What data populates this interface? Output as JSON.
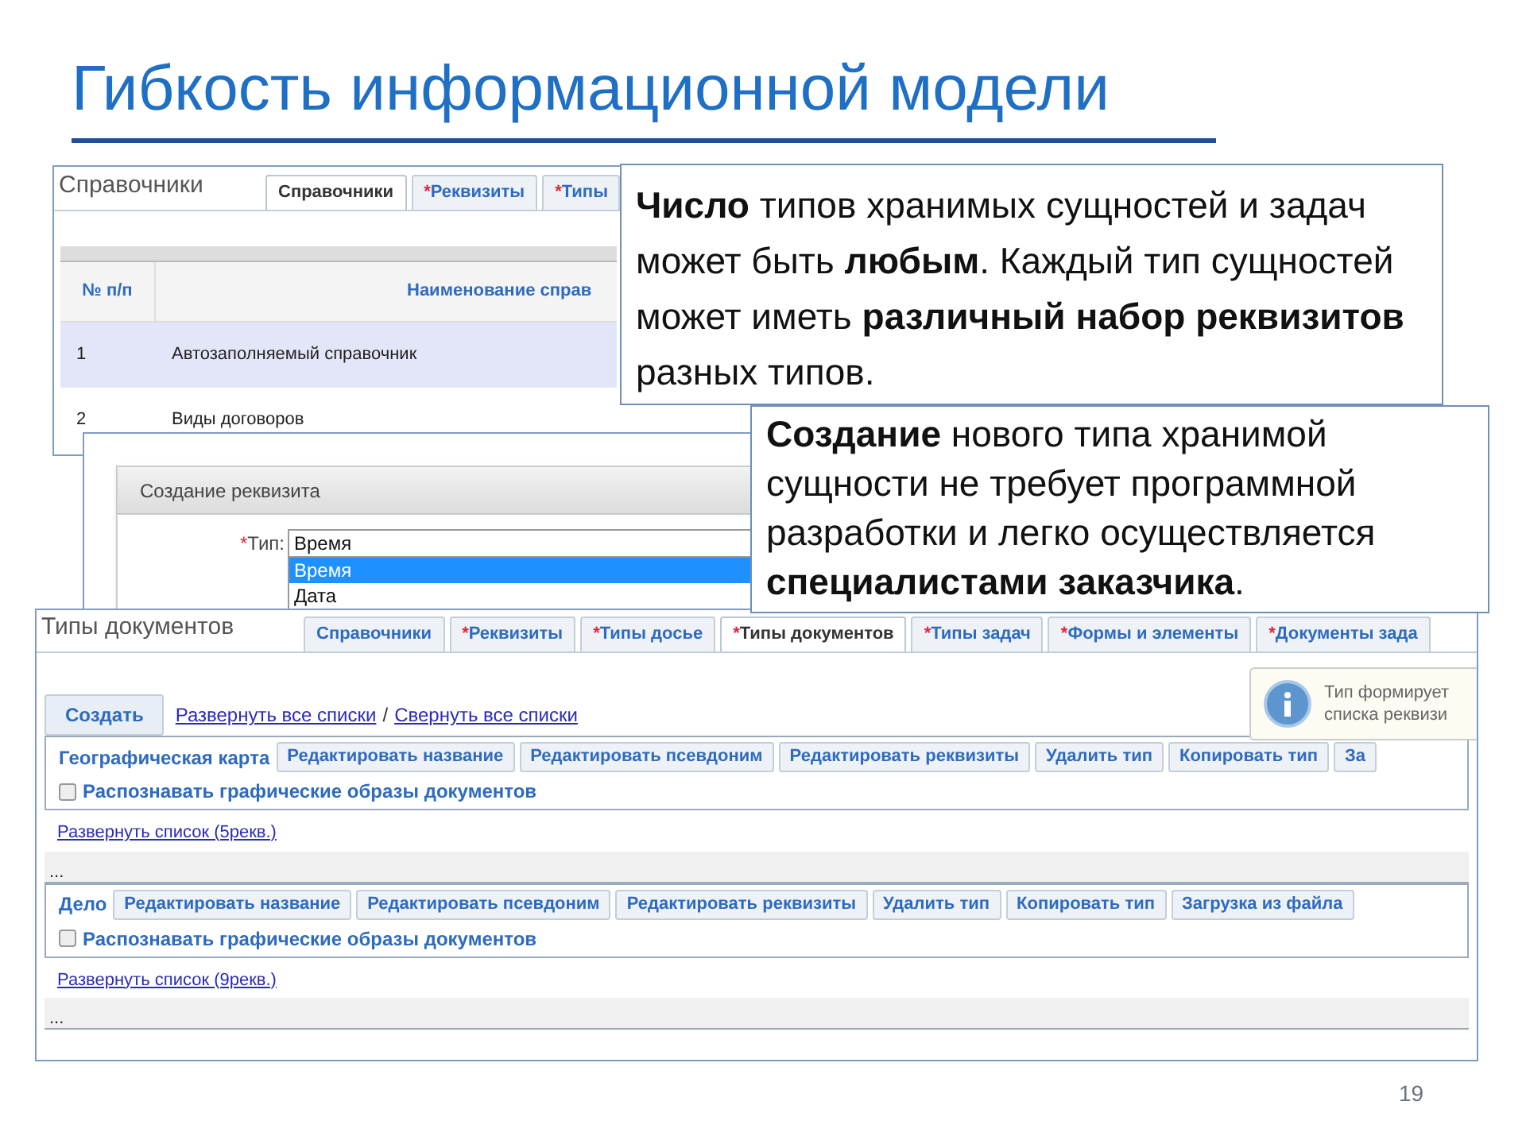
{
  "slide": {
    "title": "Гибкость информационной модели",
    "page_number": "19"
  },
  "directories_window": {
    "title": "Справочники",
    "tabs": [
      {
        "label": "Справочники",
        "selected": true
      },
      {
        "marker": "*",
        "label": "Реквизиты",
        "selected": false
      },
      {
        "marker": "*",
        "label": "Типы",
        "selected": false
      }
    ],
    "columns": [
      "№ п/п",
      "Наименование справ"
    ],
    "rows": [
      {
        "cells": [
          "1",
          "Автозаполняемый справочник"
        ],
        "selected": true
      },
      {
        "cells": [
          "2",
          "Виды договоров"
        ],
        "selected": false
      }
    ]
  },
  "attribute_dialog": {
    "title": "Создание реквизита",
    "field_label": "Тип:",
    "field_required": true,
    "value": "Время",
    "options": [
      {
        "label": "Время",
        "selected": true
      },
      {
        "label": "Дата",
        "selected": false
      }
    ]
  },
  "document_types_window": {
    "title": "Типы документов",
    "tabs": [
      {
        "label": "Справочники",
        "selected": false
      },
      {
        "marker": "*",
        "label": "Реквизиты",
        "selected": false
      },
      {
        "marker": "*",
        "label": "Типы досье",
        "selected": false
      },
      {
        "marker": "*",
        "label": "Типы документов",
        "selected": true
      },
      {
        "marker": "*",
        "label": "Типы задач",
        "selected": false
      },
      {
        "marker": "*",
        "label": "Формы и элементы",
        "selected": false
      },
      {
        "marker": "*",
        "label": "Документы зада",
        "selected": false
      }
    ],
    "create_button": "Создать",
    "expand_all": "Развернуть все списки",
    "separator": "/",
    "collapse_all": "Свернуть все списки",
    "tip_lines": [
      "Тип формирует",
      "списка реквизи"
    ],
    "groups": [
      {
        "title": "Географическая карта",
        "buttons": [
          "Редактировать название",
          "Редактировать псевдоним",
          "Редактировать реквизиты",
          "Удалить тип",
          "Копировать тип",
          "За"
        ],
        "checkbox": {
          "label": "Распознавать графические образы документов",
          "checked": false
        },
        "expand_link": "Развернуть список (5рекв.)",
        "ellipsis": "..."
      },
      {
        "title": "Дело",
        "buttons": [
          "Редактировать название",
          "Редактировать псевдоним",
          "Редактировать реквизиты",
          "Удалить тип",
          "Копировать тип",
          "Загрузка из файла"
        ],
        "checkbox": {
          "label": "Распознавать графические образы документов",
          "checked": false
        },
        "expand_link": "Развернуть список (9рекв.)",
        "ellipsis": "..."
      }
    ]
  },
  "callouts": [
    {
      "text": "**Число** типов хранимых сущностей и задач может быть **любым**. Каждый тип сущностей может иметь **различный набор реквизитов** разных типов."
    },
    {
      "text": "**Создание** нового типа хранимой сущности не требует программной разработки и легко осуществляется **специалистами заказчика**."
    }
  ]
}
